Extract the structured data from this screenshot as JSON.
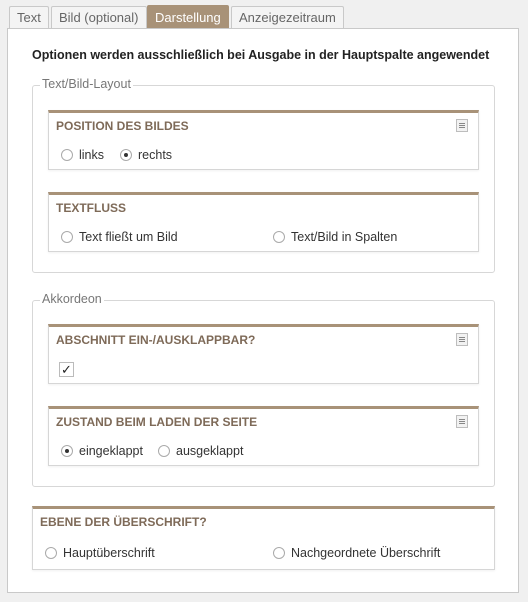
{
  "tabs": [
    {
      "label": "Text",
      "active": false
    },
    {
      "label": "Bild (optional)",
      "active": false
    },
    {
      "label": "Darstellung",
      "active": true
    },
    {
      "label": "Anzeigezeitraum",
      "active": false
    }
  ],
  "intro": "Optionen werden ausschließlich bei Ausgabe in der Hauptspalte angewendet",
  "groups": {
    "layout": {
      "legend": "Text/Bild-Layout",
      "position": {
        "title": "POSITION DES BILDES",
        "options": [
          {
            "label": "links",
            "checked": false
          },
          {
            "label": "rechts",
            "checked": true
          }
        ]
      },
      "textfluss": {
        "title": "TEXTFLUSS",
        "options": [
          {
            "label": "Text fließt um Bild",
            "checked": false
          },
          {
            "label": "Text/Bild in Spalten",
            "checked": false
          }
        ]
      }
    },
    "akkordeon": {
      "legend": "Akkordeon",
      "abschnitt": {
        "title": "ABSCHNITT EIN-/AUSKLAPPBAR?",
        "checkbox": {
          "checked": true,
          "glyph": "✓"
        }
      },
      "zustand": {
        "title": "ZUSTAND BEIM LADEN DER SEITE",
        "options": [
          {
            "label": "eingeklappt",
            "checked": true
          },
          {
            "label": "ausgeklappt",
            "checked": false
          }
        ]
      }
    }
  },
  "ebene": {
    "title": "EBENE DER ÜBERSCHRIFT?",
    "options": [
      {
        "label": "Hauptüberschrift",
        "checked": false
      },
      {
        "label": "Nachgeordnete Überschrift",
        "checked": false
      }
    ]
  },
  "colors": {
    "accent": "#a89278",
    "title": "#7e6a58"
  },
  "icons": {
    "help": "help-document-icon"
  }
}
